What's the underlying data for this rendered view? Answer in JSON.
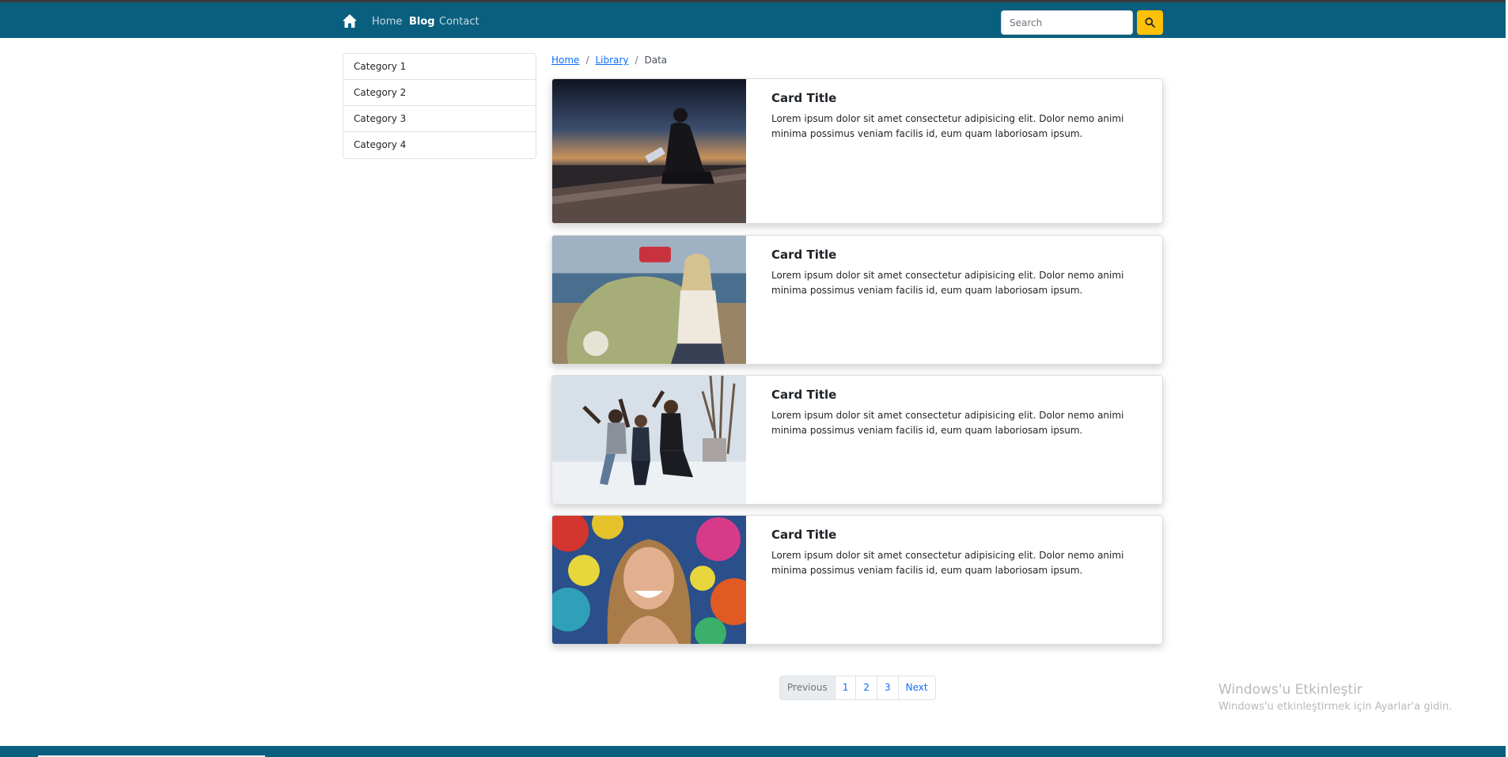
{
  "nav": {
    "links": [
      "Home",
      "Blog",
      "Contact"
    ],
    "active": "Blog",
    "search_placeholder": "Search",
    "colors": {
      "bar": "#0b5f7e",
      "search_button": "#ffc107"
    }
  },
  "sidebar": {
    "items": [
      {
        "label": "Category 1"
      },
      {
        "label": "Category 2"
      },
      {
        "label": "Category 3"
      },
      {
        "label": "Category 4"
      }
    ]
  },
  "breadcrumb": {
    "items": [
      "Home",
      "Library"
    ],
    "current": "Data"
  },
  "cards": [
    {
      "title": "Card Title",
      "text": "Lorem ipsum dolor sit amet consectetur adipisicing elit. Dolor nemo animi minima possimus veniam facilis id, eum quam laboriosam ipsum.",
      "image": "man-with-laptop-sunset-city-photo"
    },
    {
      "title": "Card Title",
      "text": "Lorem ipsum dolor sit amet consectetur adipisicing elit. Dolor nemo animi minima possimus veniam facilis id, eum quam laboriosam ipsum.",
      "image": "woman-with-vintage-car-beach-photo"
    },
    {
      "title": "Card Title",
      "text": "Lorem ipsum dolor sit amet consectetur adipisicing elit. Dolor nemo animi minima possimus veniam facilis id, eum quam laboriosam ipsum.",
      "image": "friends-jumping-snow-photo"
    },
    {
      "title": "Card Title",
      "text": "Lorem ipsum dolor sit amet consectetur adipisicing elit. Dolor nemo animi minima possimus veniam facilis id, eum quam laboriosam ipsum.",
      "image": "smiling-woman-graffiti-wall-photo"
    }
  ],
  "pagination": {
    "previous": "Previous",
    "pages": [
      "1",
      "2",
      "3"
    ],
    "next": "Next"
  },
  "watermark": {
    "title": "Windows'u Etkinleştir",
    "subtitle": "Windows'u etkinleştirmek için Ayarlar'a gidin."
  }
}
